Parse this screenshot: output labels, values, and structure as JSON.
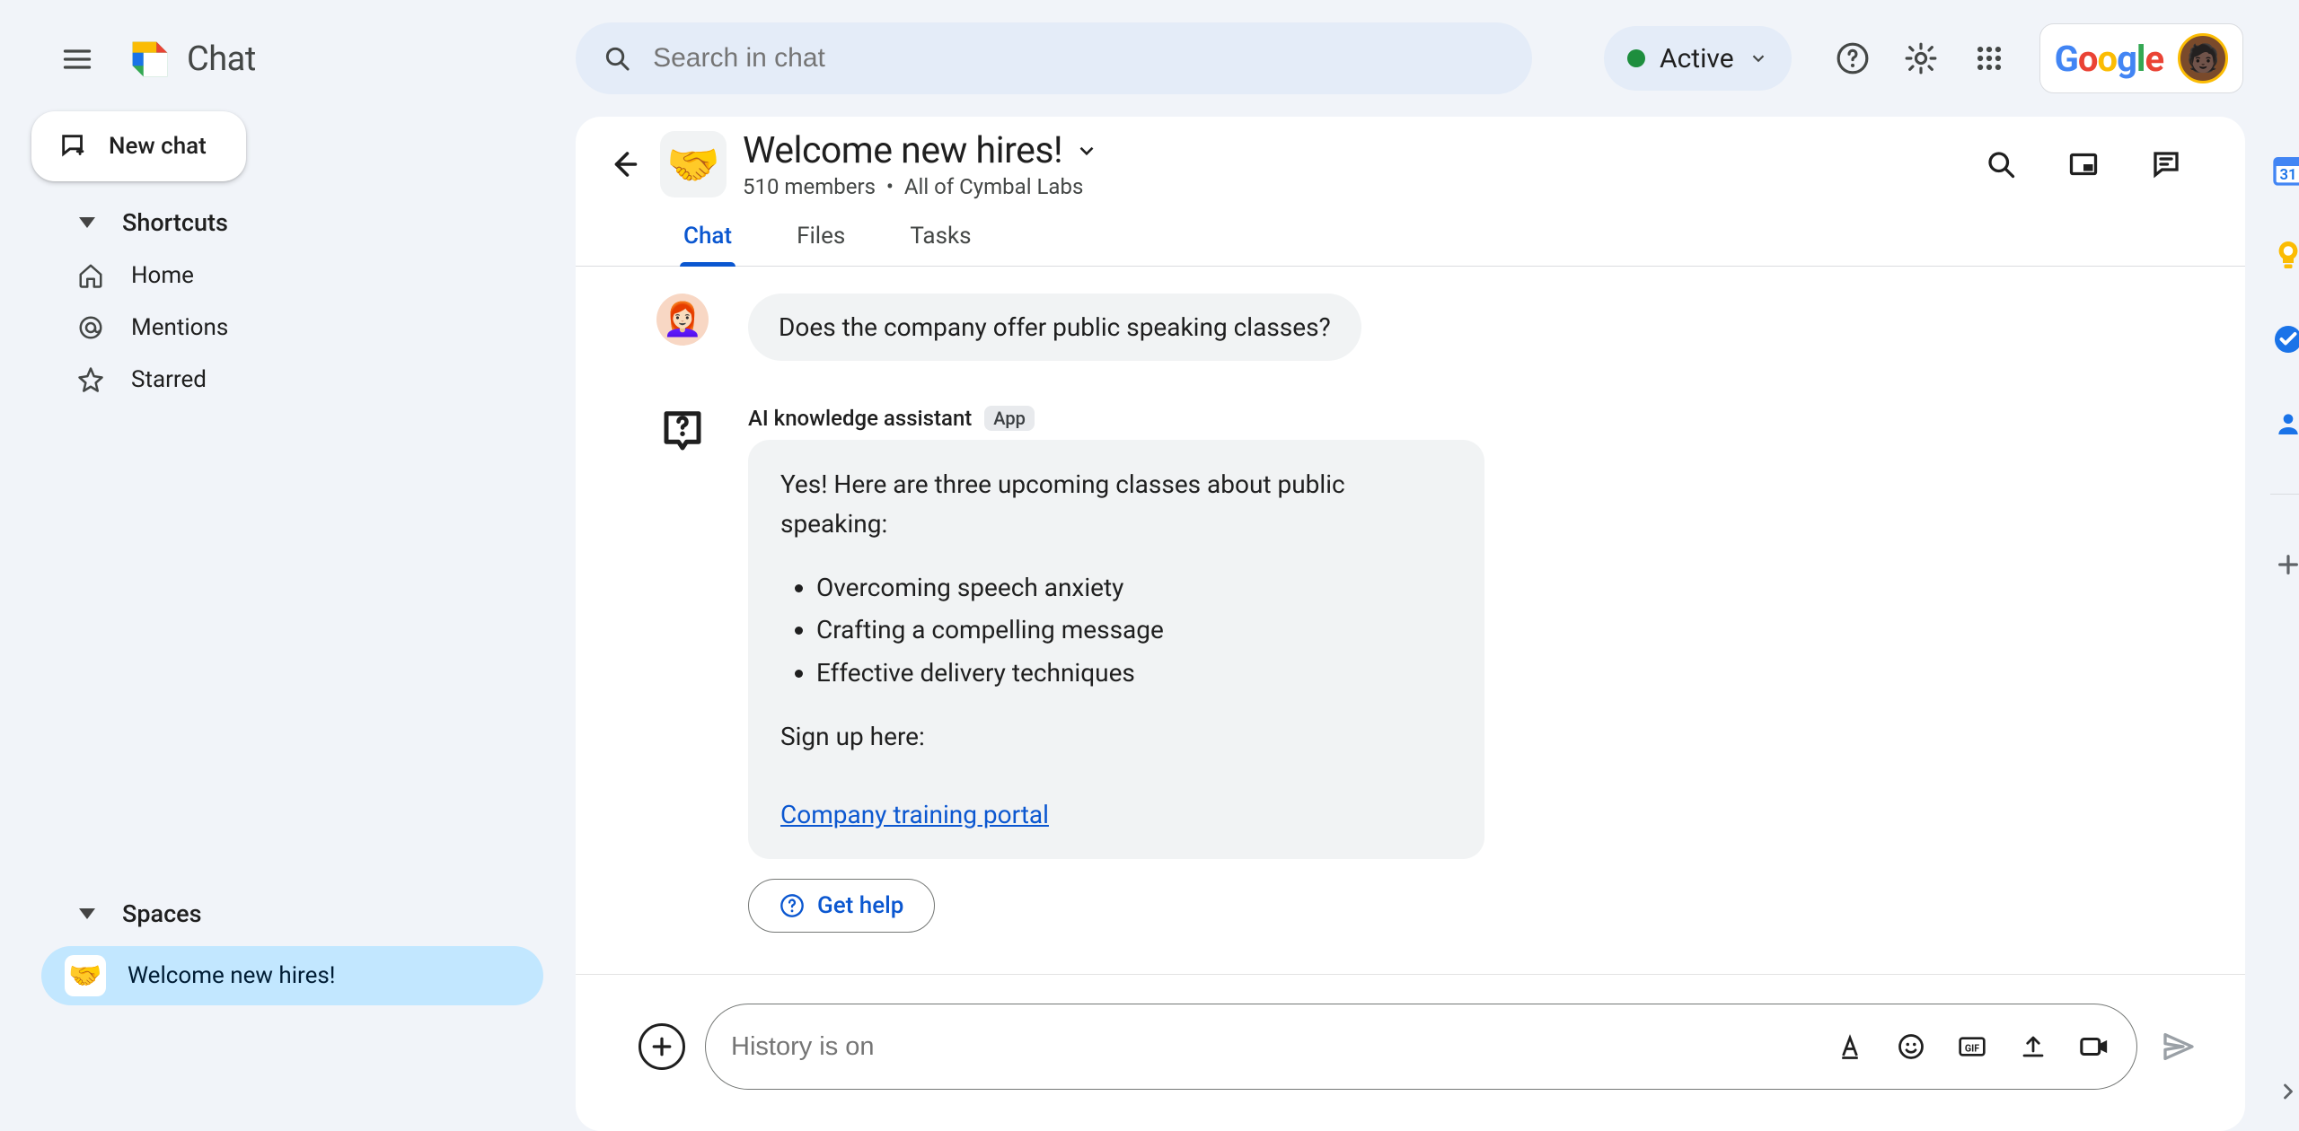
{
  "header": {
    "app_name": "Chat",
    "search_placeholder": "Search in chat",
    "status_label": "Active"
  },
  "sidebar": {
    "new_chat_label": "New chat",
    "shortcuts_label": "Shortcuts",
    "home_label": "Home",
    "mentions_label": "Mentions",
    "starred_label": "Starred",
    "spaces_label": "Spaces",
    "space_name": "Welcome new hires!"
  },
  "room": {
    "title": "Welcome new hires!",
    "members": "510 members",
    "separator": "•",
    "org": "All of Cymbal Labs",
    "tab_chat": "Chat",
    "tab_files": "Files",
    "tab_tasks": "Tasks"
  },
  "messages": {
    "user_question": "Does the company offer public speaking classes?",
    "bot_name": "AI knowledge assistant",
    "bot_chip": "App",
    "bot_intro": "Yes! Here are three upcoming classes about public speaking:",
    "bot_item1": "Overcoming speech anxiety",
    "bot_item2": "Crafting a compelling message",
    "bot_item3": "Effective delivery techniques",
    "bot_signup": "Sign up here:",
    "bot_link": "Company training portal",
    "get_help": "Get help"
  },
  "composer": {
    "placeholder": "History is on"
  }
}
